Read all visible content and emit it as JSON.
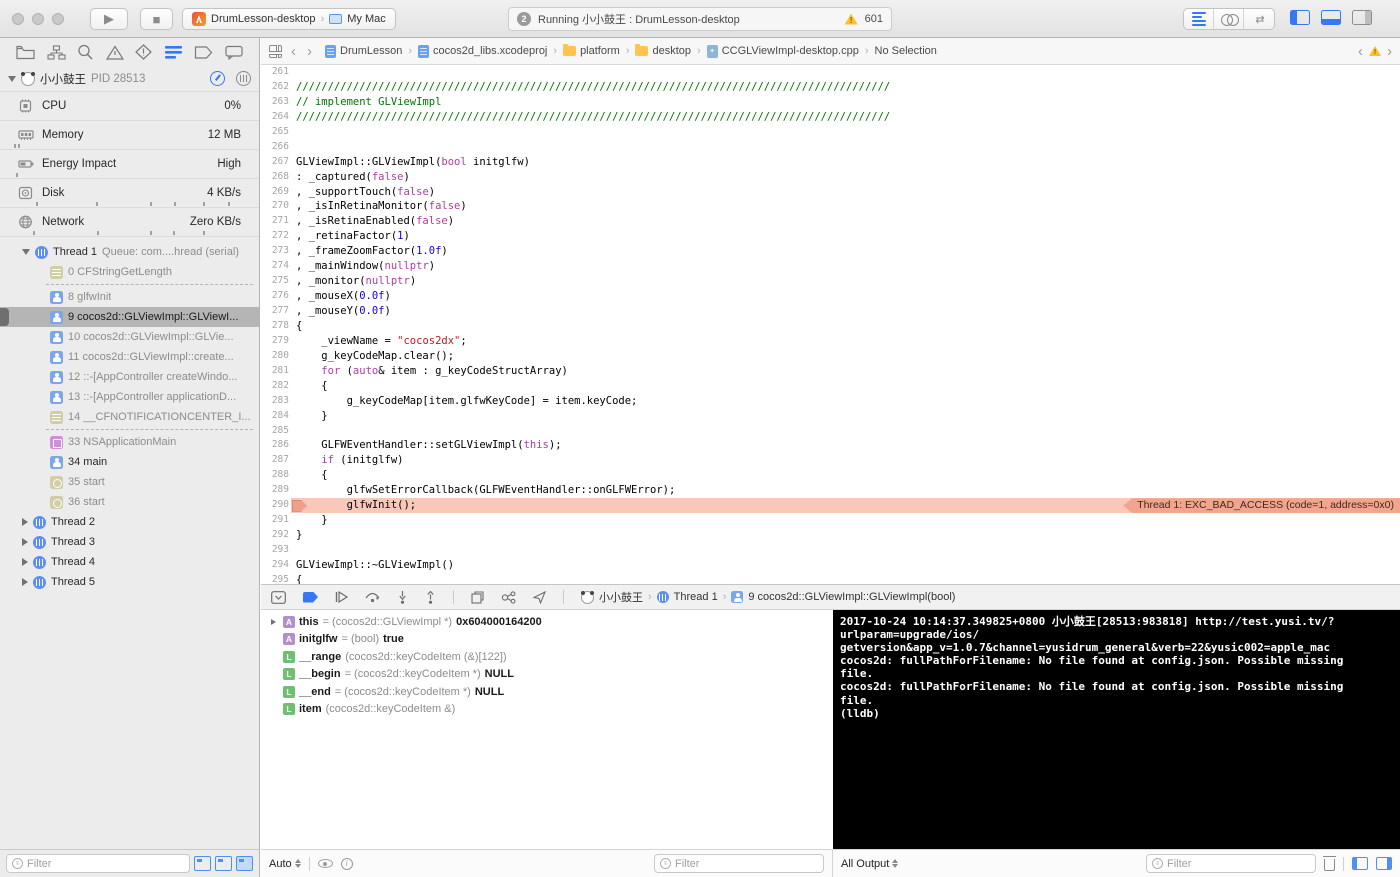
{
  "colors": {
    "accent": "#3478F6",
    "error_bg": "#F8C9B8",
    "error_badge": "#F2A58D",
    "warning": "#FDBF2D",
    "console_bg": "#000000",
    "keyword": "#AD3DA4",
    "comment": "#007400",
    "number": "#1C00CF",
    "string": "#C41A16"
  },
  "toolbar": {
    "run_icon": "▶",
    "stop_icon": "■",
    "scheme": "DrumLesson-desktop",
    "destination": "My Mac",
    "status_badge": "2",
    "status_text": "Running 小小鼓王 : DrumLesson-desktop",
    "warning_count": "601"
  },
  "navigator": {
    "process": {
      "name": "小小鼓王",
      "pid": "PID 28513"
    },
    "gauges": [
      {
        "label": "CPU",
        "value": "0%",
        "icon": "cpu-icon",
        "ticks": []
      },
      {
        "label": "Memory",
        "value": "12 MB",
        "icon": "memory-icon",
        "ticks": [
          14,
          18
        ]
      },
      {
        "label": "Energy Impact",
        "value": "High",
        "icon": "energy-icon",
        "ticks": [
          16
        ]
      },
      {
        "label": "Disk",
        "value": "4 KB/s",
        "icon": "disk-icon",
        "ticks": [
          36,
          96,
          150,
          174,
          203,
          228
        ]
      },
      {
        "label": "Network",
        "value": "Zero KB/s",
        "icon": "network-icon",
        "ticks": [
          33,
          97,
          150,
          173,
          203
        ]
      }
    ],
    "threads": [
      {
        "type": "thread",
        "label": "Thread 1",
        "queue": "Queue: com....hread (serial)",
        "expanded": true
      },
      {
        "type": "frame",
        "num": "0",
        "name": "CFStringGetLength",
        "icon": "sys",
        "dim": true
      },
      {
        "type": "sep"
      },
      {
        "type": "frame",
        "num": "8",
        "name": "glfwInit",
        "icon": "user",
        "dim": true
      },
      {
        "type": "frame",
        "num": "9",
        "name": "cocos2d::GLViewImpl::GLViewI...",
        "icon": "user",
        "selected": true
      },
      {
        "type": "frame",
        "num": "10",
        "name": "cocos2d::GLViewImpl::GLVie...",
        "icon": "user",
        "dim": true
      },
      {
        "type": "frame",
        "num": "11",
        "name": "cocos2d::GLViewImpl::create...",
        "icon": "user",
        "dim": true
      },
      {
        "type": "frame",
        "num": "12",
        "name": "::-[AppController createWindo...",
        "icon": "user",
        "dim": true
      },
      {
        "type": "frame",
        "num": "13",
        "name": "::-[AppController applicationD...",
        "icon": "user",
        "dim": true
      },
      {
        "type": "frame",
        "num": "14",
        "name": "__CFNOTIFICATIONCENTER_I...",
        "icon": "sys",
        "dim": true
      },
      {
        "type": "sep"
      },
      {
        "type": "frame",
        "num": "33",
        "name": "NSApplicationMain",
        "icon": "fw",
        "dim": true
      },
      {
        "type": "frame",
        "num": "34",
        "name": "main",
        "icon": "user",
        "dim": false
      },
      {
        "type": "frame",
        "num": "35",
        "name": "start",
        "icon": "sys2",
        "dim": true
      },
      {
        "type": "frame",
        "num": "36",
        "name": "start",
        "icon": "sys2",
        "dim": true
      },
      {
        "type": "thread",
        "label": "Thread 2",
        "queue": "",
        "expanded": false
      },
      {
        "type": "thread",
        "label": "Thread 3",
        "queue": "",
        "expanded": false
      },
      {
        "type": "thread",
        "label": "Thread 4",
        "queue": "",
        "expanded": false
      },
      {
        "type": "thread",
        "label": "Thread 5",
        "queue": "",
        "expanded": false
      }
    ],
    "filter_placeholder": "Filter"
  },
  "jumpbar": {
    "crumbs": [
      {
        "label": "DrumLesson",
        "icon": "project"
      },
      {
        "label": "cocos2d_libs.xcodeproj",
        "icon": "project"
      },
      {
        "label": "platform",
        "icon": "folder"
      },
      {
        "label": "desktop",
        "icon": "folder"
      },
      {
        "label": "CCGLViewImpl-desktop.cpp",
        "icon": "cpp"
      },
      {
        "label": "No Selection",
        "icon": null
      }
    ]
  },
  "editor": {
    "lines": [
      {
        "n": 261,
        "s": []
      },
      {
        "n": 262,
        "s": [
          {
            "t": "//////////////////////////////////////////////////////////////////////////////////////////////",
            "c": "com"
          }
        ]
      },
      {
        "n": 263,
        "s": [
          {
            "t": "// implement GLViewImpl",
            "c": "com"
          }
        ]
      },
      {
        "n": 264,
        "s": [
          {
            "t": "//////////////////////////////////////////////////////////////////////////////////////////////",
            "c": "com"
          }
        ]
      },
      {
        "n": 265,
        "s": []
      },
      {
        "n": 266,
        "s": []
      },
      {
        "n": 267,
        "s": [
          {
            "t": "GLViewImpl::GLViewImpl(",
            "c": "pl"
          },
          {
            "t": "bool",
            "c": "kw"
          },
          {
            "t": " initglfw)",
            "c": "pl"
          }
        ]
      },
      {
        "n": 268,
        "s": [
          {
            "t": ": _captured(",
            "c": "pl"
          },
          {
            "t": "false",
            "c": "kw"
          },
          {
            "t": ")",
            "c": "pl"
          }
        ]
      },
      {
        "n": 269,
        "s": [
          {
            "t": ", _supportTouch(",
            "c": "pl"
          },
          {
            "t": "false",
            "c": "kw"
          },
          {
            "t": ")",
            "c": "pl"
          }
        ]
      },
      {
        "n": 270,
        "s": [
          {
            "t": ", _isInRetinaMonitor(",
            "c": "pl"
          },
          {
            "t": "false",
            "c": "kw"
          },
          {
            "t": ")",
            "c": "pl"
          }
        ]
      },
      {
        "n": 271,
        "s": [
          {
            "t": ", _isRetinaEnabled(",
            "c": "pl"
          },
          {
            "t": "false",
            "c": "kw"
          },
          {
            "t": ")",
            "c": "pl"
          }
        ]
      },
      {
        "n": 272,
        "s": [
          {
            "t": ", _retinaFactor(",
            "c": "pl"
          },
          {
            "t": "1",
            "c": "num"
          },
          {
            "t": ")",
            "c": "pl"
          }
        ]
      },
      {
        "n": 273,
        "s": [
          {
            "t": ", _frameZoomFactor(",
            "c": "pl"
          },
          {
            "t": "1.0f",
            "c": "num"
          },
          {
            "t": ")",
            "c": "pl"
          }
        ]
      },
      {
        "n": 274,
        "s": [
          {
            "t": ", _mainWindow(",
            "c": "pl"
          },
          {
            "t": "nullptr",
            "c": "kw"
          },
          {
            "t": ")",
            "c": "pl"
          }
        ]
      },
      {
        "n": 275,
        "s": [
          {
            "t": ", _monitor(",
            "c": "pl"
          },
          {
            "t": "nullptr",
            "c": "kw"
          },
          {
            "t": ")",
            "c": "pl"
          }
        ]
      },
      {
        "n": 276,
        "s": [
          {
            "t": ", _mouseX(",
            "c": "pl"
          },
          {
            "t": "0.0f",
            "c": "num"
          },
          {
            "t": ")",
            "c": "pl"
          }
        ]
      },
      {
        "n": 277,
        "s": [
          {
            "t": ", _mouseY(",
            "c": "pl"
          },
          {
            "t": "0.0f",
            "c": "num"
          },
          {
            "t": ")",
            "c": "pl"
          }
        ]
      },
      {
        "n": 278,
        "s": [
          {
            "t": "{",
            "c": "pl"
          }
        ]
      },
      {
        "n": 279,
        "s": [
          {
            "t": "    _viewName = ",
            "c": "pl"
          },
          {
            "t": "\"cocos2dx\"",
            "c": "str"
          },
          {
            "t": ";",
            "c": "pl"
          }
        ]
      },
      {
        "n": 280,
        "s": [
          {
            "t": "    g_keyCodeMap.clear();",
            "c": "pl"
          }
        ]
      },
      {
        "n": 281,
        "s": [
          {
            "t": "    ",
            "c": "pl"
          },
          {
            "t": "for",
            "c": "kw"
          },
          {
            "t": " (",
            "c": "pl"
          },
          {
            "t": "auto",
            "c": "kw"
          },
          {
            "t": "& item : g_keyCodeStructArray)",
            "c": "pl"
          }
        ]
      },
      {
        "n": 282,
        "s": [
          {
            "t": "    {",
            "c": "pl"
          }
        ]
      },
      {
        "n": 283,
        "s": [
          {
            "t": "        g_keyCodeMap[item.glfwKeyCode] = item.keyCode;",
            "c": "pl"
          }
        ]
      },
      {
        "n": 284,
        "s": [
          {
            "t": "    }",
            "c": "pl"
          }
        ]
      },
      {
        "n": 285,
        "s": []
      },
      {
        "n": 286,
        "s": [
          {
            "t": "    GLFWEventHandler::setGLViewImpl(",
            "c": "pl"
          },
          {
            "t": "this",
            "c": "kw"
          },
          {
            "t": ");",
            "c": "pl"
          }
        ]
      },
      {
        "n": 287,
        "s": [
          {
            "t": "    ",
            "c": "pl"
          },
          {
            "t": "if",
            "c": "kw"
          },
          {
            "t": " (initglfw)",
            "c": "pl"
          }
        ]
      },
      {
        "n": 288,
        "s": [
          {
            "t": "    {",
            "c": "pl"
          }
        ]
      },
      {
        "n": 289,
        "s": [
          {
            "t": "        glfwSetErrorCallback(GLFWEventHandler::onGLFWError);",
            "c": "pl"
          }
        ]
      },
      {
        "n": 290,
        "s": [
          {
            "t": "        glfwInit();",
            "c": "pl"
          }
        ],
        "error": "Thread 1: EXC_BAD_ACCESS (code=1, address=0x0)"
      },
      {
        "n": 291,
        "s": [
          {
            "t": "    }",
            "c": "pl"
          }
        ]
      },
      {
        "n": 292,
        "s": [
          {
            "t": "}",
            "c": "pl"
          }
        ]
      },
      {
        "n": 293,
        "s": []
      },
      {
        "n": 294,
        "s": [
          {
            "t": "GLViewImpl::~GLViewImpl()",
            "c": "pl"
          }
        ]
      },
      {
        "n": 295,
        "s": [
          {
            "t": "{",
            "c": "pl"
          }
        ]
      }
    ]
  },
  "debugbar": {
    "process": "小小鼓王",
    "thread": "Thread 1",
    "frame": "9 cocos2d::GLViewImpl::GLViewImpl(bool)"
  },
  "variables": {
    "rows": [
      {
        "icon": "A",
        "expand": true,
        "name": "this",
        "eq": " = ",
        "type": "(cocos2d::GLViewImpl *) ",
        "value": "0x604000164200"
      },
      {
        "icon": "A",
        "expand": false,
        "name": "initglfw",
        "eq": " = ",
        "type": "(bool) ",
        "value": "true"
      },
      {
        "icon": "L",
        "expand": false,
        "name": "__range",
        "eq": " ",
        "type": "(cocos2d::keyCodeItem (&)[122])",
        "value": ""
      },
      {
        "icon": "L",
        "expand": false,
        "name": "__begin",
        "eq": " = ",
        "type": "(cocos2d::keyCodeItem *) ",
        "value": "NULL"
      },
      {
        "icon": "L",
        "expand": false,
        "name": "__end",
        "eq": " = ",
        "type": "(cocos2d::keyCodeItem *) ",
        "value": "NULL"
      },
      {
        "icon": "L",
        "expand": false,
        "name": "item",
        "eq": " ",
        "type": "(cocos2d::keyCodeItem &)",
        "value": ""
      }
    ],
    "scope": "Auto",
    "filter_placeholder": "Filter"
  },
  "console": {
    "lines": [
      "2017-10-24 10:14:37.349825+0800 小小鼓王[28513:983818] http://test.yusi.tv/?",
      "urlparam=upgrade/ios/",
      "getversion&app_v=1.0.7&channel=yusidrum_general&verb=22&yusic002=apple_mac",
      "cocos2d: fullPathForFilename: No file found at config.json. Possible missing",
      "file.",
      "cocos2d: fullPathForFilename: No file found at config.json. Possible missing",
      "file.",
      "(lldb)"
    ],
    "output_mode": "All Output",
    "filter_placeholder": "Filter"
  }
}
